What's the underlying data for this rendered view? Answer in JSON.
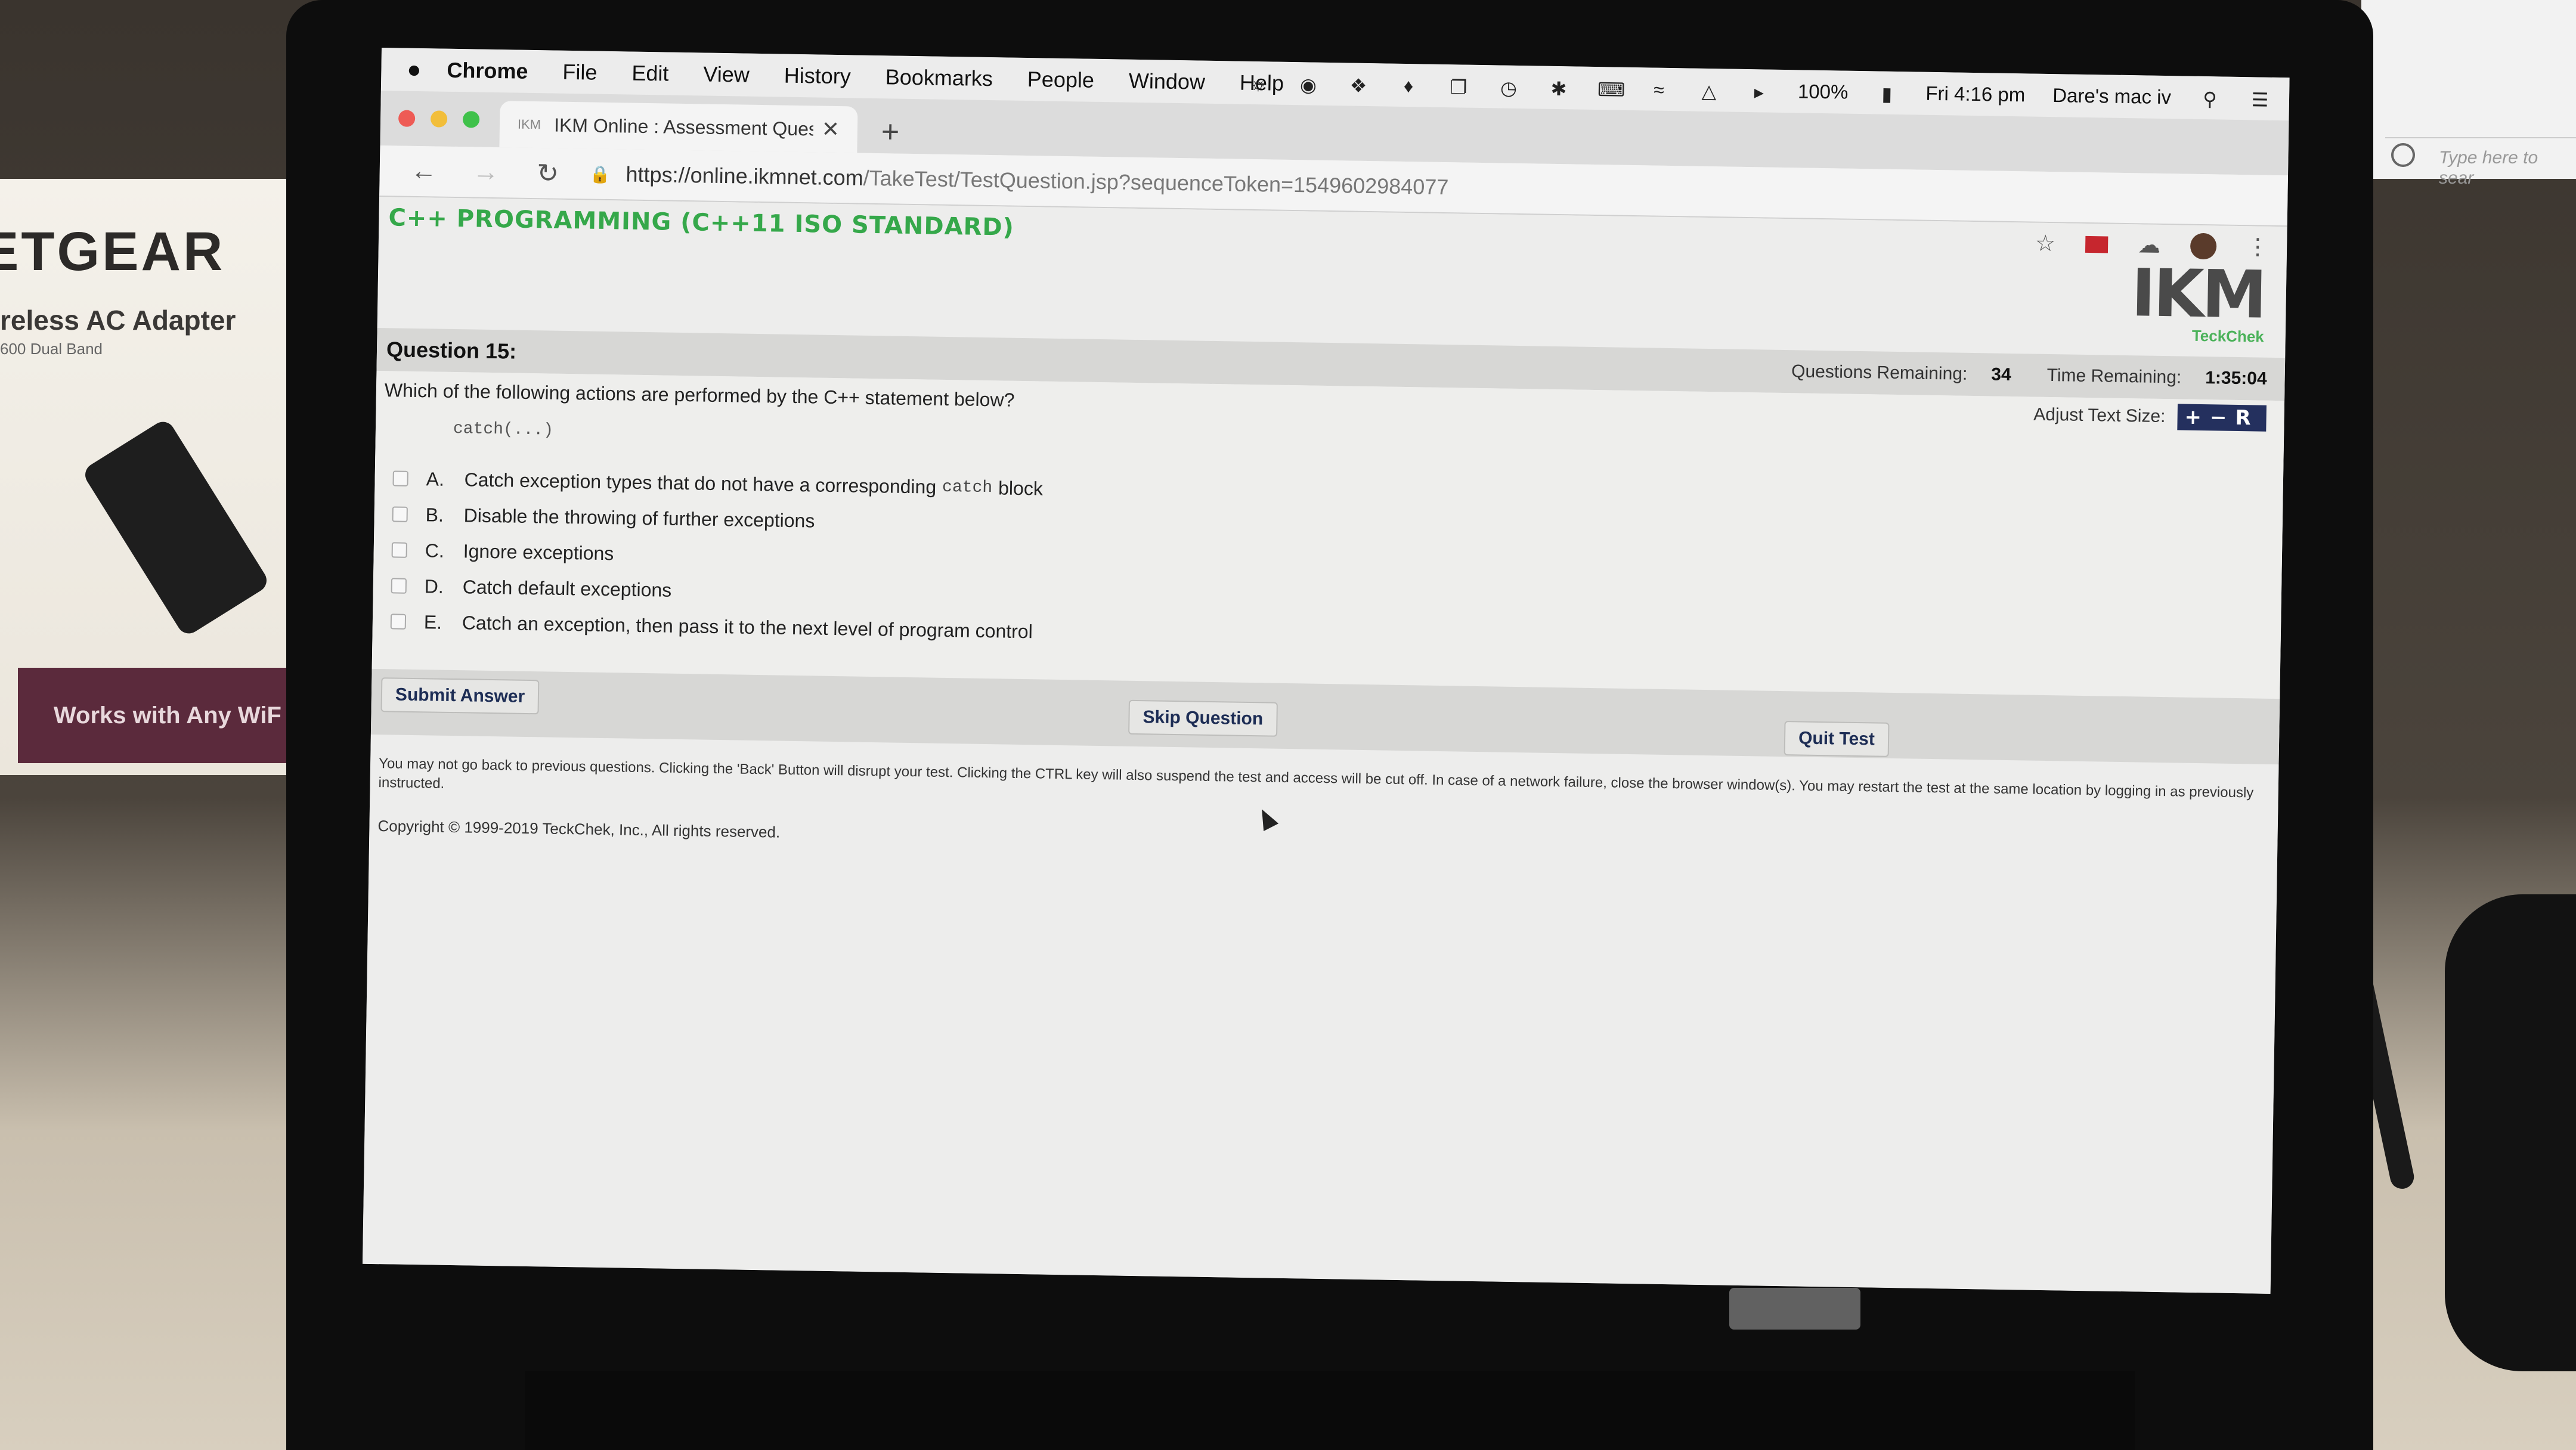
{
  "background": {
    "box_brand": "ETGEAR",
    "box_sub": "reless AC Adapter",
    "box_sub2": "600 Dual Band",
    "box_band": "Works with Any WiF",
    "monitor_search": "Type here to sear"
  },
  "menubar": {
    "apple": "",
    "items": [
      "Chrome",
      "File",
      "Edit",
      "View",
      "History",
      "Bookmarks",
      "People",
      "Window",
      "Help"
    ],
    "battery": "100%",
    "clock": "Fri 4:16 pm",
    "user": "Dare's mac iv"
  },
  "browser": {
    "tab_title": "IKM Online : Assessment Ques",
    "tab_favicon": "IKM",
    "new_tab": "+",
    "url_host": "https://online.ikmnet.com",
    "url_path": "/TakeTest/TestQuestion.jsp?sequenceToken=1549602984077"
  },
  "page": {
    "course_title": "C++ PROGRAMMING (C++11 ISO STANDARD)",
    "logo": "IKM",
    "logo_tag": "TeckChek",
    "question_label": "Question 15:",
    "questions_remaining_label": "Questions Remaining:",
    "questions_remaining": "34",
    "time_remaining_label": "Time Remaining:",
    "time_remaining": "1:35:04",
    "question_text": "Which of the following actions are performed by the C++ statement below?",
    "adjust_text_label": "Adjust Text Size:",
    "adjust_text_controls": "+−R",
    "code": "catch(...)",
    "options": [
      {
        "letter": "A.",
        "text_before": "Catch exception types that do not have a corresponding",
        "code": "catch",
        "text_after": "block"
      },
      {
        "letter": "B.",
        "text": "Disable the throwing of further exceptions"
      },
      {
        "letter": "C.",
        "text": "Ignore exceptions"
      },
      {
        "letter": "D.",
        "text": "Catch default exceptions"
      },
      {
        "letter": "E.",
        "text": "Catch an exception, then pass it to the next level of program control"
      }
    ],
    "submit_label": "Submit Answer",
    "skip_label": "Skip Question",
    "quit_label": "Quit Test",
    "notice": "You may not go back to previous questions. Clicking the 'Back' Button will disrupt your test. Clicking the CTRL key will also suspend the test and access will be cut off. In case of a network failure, close the browser window(s). You may restart the test at the same location by logging in as previously instructed.",
    "copyright": "Copyright © 1999-2019 TeckChek, Inc., All rights reserved."
  },
  "colors": {
    "course_green": "#35a84a",
    "button_text": "#1d2d55",
    "text_size_control": "#24305e",
    "close_red": "#ee5b55",
    "min_yellow": "#f2be3a",
    "max_green": "#3fc14a"
  }
}
